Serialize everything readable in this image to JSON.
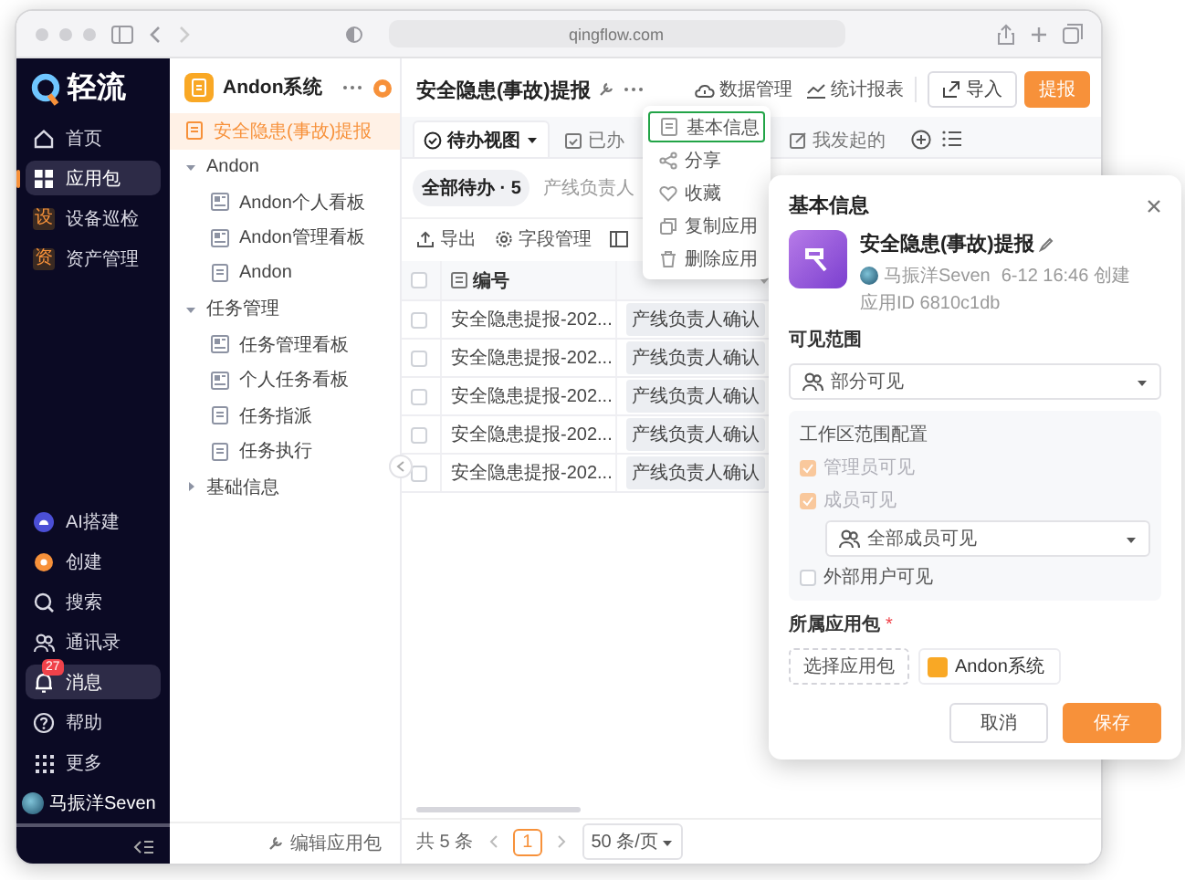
{
  "browser": {
    "url": "qingflow.com"
  },
  "nav": {
    "logo": "轻流",
    "items": [
      {
        "label": "首页",
        "kind": "home",
        "selected": false
      },
      {
        "label": "应用包",
        "kind": "grid",
        "selected": true
      },
      {
        "label": "设备巡检",
        "kind": "letter",
        "icon_text": "设",
        "selected": false
      },
      {
        "label": "资产管理",
        "kind": "letter",
        "icon_text": "资",
        "selected": false
      }
    ],
    "bottom_items": [
      {
        "label": "AI搭建",
        "kind": "ai",
        "highlighted": false
      },
      {
        "label": "创建",
        "kind": "create",
        "highlighted": false
      },
      {
        "label": "搜索",
        "kind": "search",
        "highlighted": false
      },
      {
        "label": "通讯录",
        "kind": "contacts",
        "highlighted": false
      },
      {
        "label": "消息",
        "kind": "bell",
        "badge": "27",
        "highlighted": true
      },
      {
        "label": "帮助",
        "kind": "help",
        "highlighted": false
      },
      {
        "label": "更多",
        "kind": "more",
        "highlighted": false
      }
    ],
    "user": {
      "name": "马振洋Seven"
    }
  },
  "app_panel": {
    "title": "Andon系统",
    "items": [
      {
        "label": "安全隐患(事故)提报",
        "kind": "form",
        "selected": true
      },
      {
        "label": "Andon",
        "kind": "group",
        "expanded": true,
        "children": [
          {
            "label": "Andon个人看板",
            "kind": "board",
            "selected": false
          },
          {
            "label": "Andon管理看板",
            "kind": "board",
            "selected": false
          },
          {
            "label": "Andon",
            "kind": "form",
            "selected": false
          }
        ]
      },
      {
        "label": "任务管理",
        "kind": "group",
        "expanded": true,
        "children": [
          {
            "label": "任务管理看板",
            "kind": "board",
            "selected": false
          },
          {
            "label": "个人任务看板",
            "kind": "board",
            "selected": false
          },
          {
            "label": "任务指派",
            "kind": "form",
            "selected": false
          },
          {
            "label": "任务执行",
            "kind": "form",
            "selected": false
          }
        ]
      },
      {
        "label": "基础信息",
        "kind": "group",
        "expanded": false
      }
    ],
    "footer": "编辑应用包"
  },
  "main": {
    "title": "安全隐患(事故)提报",
    "actions": [
      {
        "label": "数据管理",
        "kind": "data"
      },
      {
        "label": "统计报表",
        "kind": "chart"
      }
    ],
    "buttons": [
      {
        "label": "导入",
        "kind": "secondary"
      },
      {
        "label": "提报",
        "kind": "primary"
      }
    ],
    "views": [
      {
        "label": "待办视图",
        "kind": "check",
        "selected": true
      },
      {
        "label": "已办",
        "kind": "calendar",
        "selected": false
      },
      {
        "label": "我发起的",
        "kind": "send",
        "selected": false
      }
    ],
    "filters": [
      {
        "label": "全部待办 · 5",
        "selected": true
      },
      {
        "label": "产线负责人",
        "selected": false
      }
    ],
    "tools": [
      {
        "label": "导出",
        "kind": "export"
      },
      {
        "label": "字段管理",
        "kind": "gear"
      }
    ],
    "table": {
      "columns": [
        "编号"
      ],
      "all_checked": false,
      "rows": [
        {
          "column_1": "安全隐患提报-202...",
          "column_2": "产线负责人确认",
          "checked": false
        },
        {
          "column_1": "安全隐患提报-202...",
          "column_2": "产线负责人确认",
          "checked": false
        },
        {
          "column_1": "安全隐患提报-202...",
          "column_2": "产线负责人确认",
          "checked": false
        },
        {
          "column_1": "安全隐患提报-202...",
          "column_2": "产线负责人确认",
          "checked": false
        },
        {
          "column_1": "安全隐患提报-202...",
          "column_2": "产线负责人确认",
          "checked": false
        }
      ]
    },
    "pagination": {
      "total": "共 5 条",
      "page": "1",
      "page_size": "50 条/页"
    }
  },
  "menu": {
    "items": [
      {
        "label": "基本信息",
        "kind": "doc",
        "selected": true
      },
      {
        "label": "分享",
        "kind": "share",
        "selected": false
      },
      {
        "label": "收藏",
        "kind": "heart",
        "selected": false
      },
      {
        "label": "复制应用",
        "kind": "copy",
        "selected": false
      },
      {
        "label": "删除应用",
        "kind": "trash",
        "selected": false
      }
    ]
  },
  "dialog": {
    "title": "基本信息",
    "app_name": "安全隐患(事故)提报",
    "author": "马振洋Seven",
    "created": "6-12 16:46 创建",
    "app_id": "应用ID 6810c1db",
    "visibility_label": "可见范围",
    "visibility": "部分可见",
    "scope_title": "工作区范围配置",
    "scope_options": [
      {
        "label": "管理员可见",
        "checked": true,
        "disabled": true
      },
      {
        "label": "成员可见",
        "checked": true,
        "disabled": true
      }
    ],
    "member_scope": "全部成员可见",
    "external": {
      "label": "外部用户可见",
      "checked": false
    },
    "package_label": "所属应用包",
    "required_mark": "*",
    "package_button": "选择应用包",
    "package": "Andon系统",
    "buttons": [
      {
        "label": "取消",
        "kind": "secondary"
      },
      {
        "label": "保存",
        "kind": "primary"
      }
    ]
  }
}
